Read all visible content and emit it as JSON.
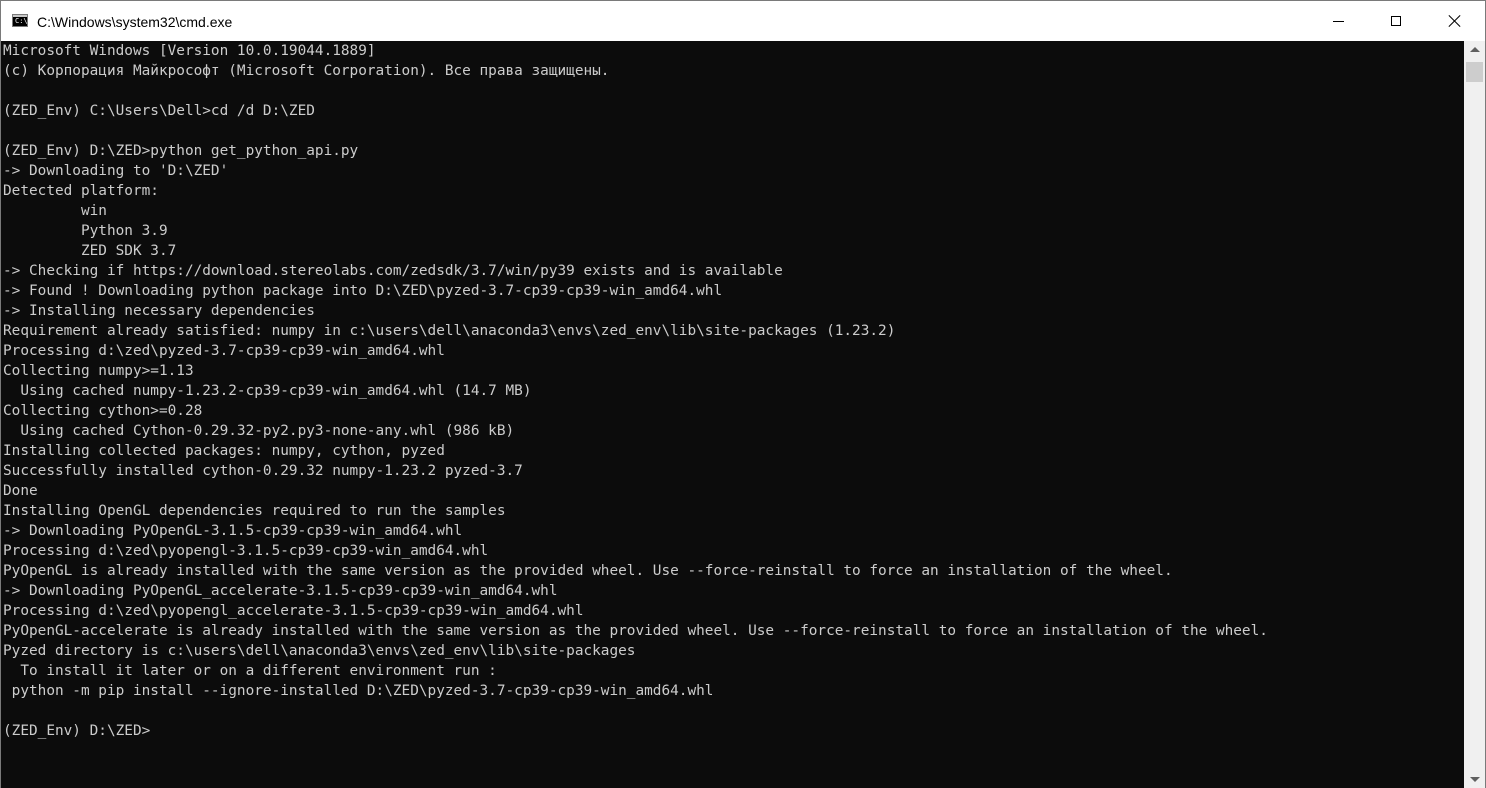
{
  "window": {
    "title": "C:\\Windows\\system32\\cmd.exe",
    "icon": "cmd-icon",
    "icon_glyph": "C:\\"
  },
  "controls": {
    "minimize_icon": "minimize-icon",
    "maximize_icon": "maximize-icon",
    "close_icon": "close-icon"
  },
  "colors": {
    "console_bg": "#0c0c0c",
    "console_text": "#cccccc"
  },
  "console": {
    "lines": [
      "Microsoft Windows [Version 10.0.19044.1889]",
      "(c) Корпорация Майкрософт (Microsoft Corporation). Все права защищены.",
      "",
      "(ZED_Env) C:\\Users\\Dell>cd /d D:\\ZED",
      "",
      "(ZED_Env) D:\\ZED>python get_python_api.py",
      "-> Downloading to 'D:\\ZED'",
      "Detected platform:",
      "         win",
      "         Python 3.9",
      "         ZED SDK 3.7",
      "-> Checking if https://download.stereolabs.com/zedsdk/3.7/win/py39 exists and is available",
      "-> Found ! Downloading python package into D:\\ZED\\pyzed-3.7-cp39-cp39-win_amd64.whl",
      "-> Installing necessary dependencies",
      "Requirement already satisfied: numpy in c:\\users\\dell\\anaconda3\\envs\\zed_env\\lib\\site-packages (1.23.2)",
      "Processing d:\\zed\\pyzed-3.7-cp39-cp39-win_amd64.whl",
      "Collecting numpy>=1.13",
      "  Using cached numpy-1.23.2-cp39-cp39-win_amd64.whl (14.7 MB)",
      "Collecting cython>=0.28",
      "  Using cached Cython-0.29.32-py2.py3-none-any.whl (986 kB)",
      "Installing collected packages: numpy, cython, pyzed",
      "Successfully installed cython-0.29.32 numpy-1.23.2 pyzed-3.7",
      "Done",
      "Installing OpenGL dependencies required to run the samples",
      "-> Downloading PyOpenGL-3.1.5-cp39-cp39-win_amd64.whl",
      "Processing d:\\zed\\pyopengl-3.1.5-cp39-cp39-win_amd64.whl",
      "PyOpenGL is already installed with the same version as the provided wheel. Use --force-reinstall to force an installation of the wheel.",
      "-> Downloading PyOpenGL_accelerate-3.1.5-cp39-cp39-win_amd64.whl",
      "Processing d:\\zed\\pyopengl_accelerate-3.1.5-cp39-cp39-win_amd64.whl",
      "PyOpenGL-accelerate is already installed with the same version as the provided wheel. Use --force-reinstall to force an installation of the wheel.",
      "Pyzed directory is c:\\users\\dell\\anaconda3\\envs\\zed_env\\lib\\site-packages",
      "  To install it later or on a different environment run :",
      " python -m pip install --ignore-installed D:\\ZED\\pyzed-3.7-cp39-cp39-win_amd64.whl",
      "",
      "(ZED_Env) D:\\ZED>"
    ]
  },
  "scrollbar": {
    "up_icon": "scroll-up-arrow-icon",
    "down_icon": "scroll-down-arrow-icon"
  }
}
